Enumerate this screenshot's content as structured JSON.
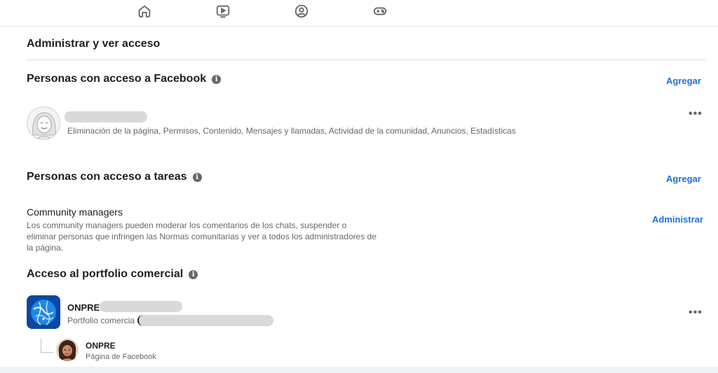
{
  "nav": {
    "icons": [
      "home-icon",
      "video-icon",
      "profile-icon",
      "gaming-icon"
    ]
  },
  "page": {
    "title": "Administrar y ver acceso"
  },
  "facebook_access": {
    "title": "Personas con acceso a Facebook",
    "add_label": "Agregar",
    "person": {
      "permissions": "Eliminación de la página, Permisos, Contenido, Mensajes y llamadas, Actividad de la comunidad, Anuncios, Estadísticas"
    }
  },
  "task_access": {
    "title": "Personas con acceso a tareas",
    "add_label": "Agregar",
    "community_managers": {
      "title": "Community managers",
      "description": "Los community managers pueden moderar los comentarios de los chats, suspender o eliminar personas que infringen las Normas comunitarias y ver a todos los administradores de la página.",
      "manage_label": "Administrar"
    }
  },
  "business_portfolio": {
    "title": "Acceso al portfolio comercial",
    "org": {
      "name": "ONPRE",
      "subtitle": "Portfolio comercia"
    },
    "page": {
      "name": "ONPRE",
      "subtitle": "Página de Facebook"
    }
  },
  "colors": {
    "link": "#216fdb",
    "muted": "#65676b"
  }
}
